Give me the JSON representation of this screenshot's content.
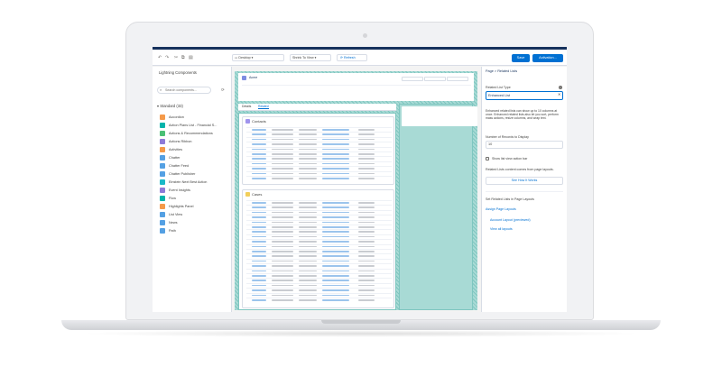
{
  "toolbar": {
    "device_label": "Desktop",
    "shrink_label": "Shrink To View",
    "refresh_label": "Refresh",
    "save_label": "Save",
    "activation_label": "Activation..."
  },
  "left_panel": {
    "title": "Lightning Components",
    "search_placeholder": "Search components...",
    "section_label": "Standard (33)",
    "components": [
      {
        "label": "Accordion",
        "color": "#f59a4a"
      },
      {
        "label": "Action Plans List - Financial S...",
        "color": "#04b4ab"
      },
      {
        "label": "Actions & Recommendations",
        "color": "#4bc076"
      },
      {
        "label": "Actions Ribbon",
        "color": "#8e7bd8"
      },
      {
        "label": "Activities",
        "color": "#f59a4a"
      },
      {
        "label": "Chatter",
        "color": "#54a0e3"
      },
      {
        "label": "Chatter Feed",
        "color": "#54a0e3"
      },
      {
        "label": "Chatter Publisher",
        "color": "#54a0e3"
      },
      {
        "label": "Einstein Next Best Action",
        "color": "#1ab9c8"
      },
      {
        "label": "Event Insights",
        "color": "#8e7bd8"
      },
      {
        "label": "Flow",
        "color": "#04b4ab"
      },
      {
        "label": "Highlights Panel",
        "color": "#f59a4a"
      },
      {
        "label": "List View",
        "color": "#54a0e3"
      },
      {
        "label": "News",
        "color": "#54a0e3"
      },
      {
        "label": "Path",
        "color": "#54a0e3"
      }
    ]
  },
  "canvas": {
    "account_name": "Acme",
    "tab_details": "Details",
    "tab_related": "Related",
    "contacts_title": "Contacts",
    "cases_title": "Cases"
  },
  "right_panel": {
    "breadcrumb": "Page  >  Related Lists",
    "list_type_label": "Related List Type",
    "list_type_value": "Enhanced List",
    "description": "Enhanced related lists can show up to 10 columns at once. Enhanced related lists also let you sort, perform mass actions, resize columns, and wrap text.",
    "records_label": "Number of Records to Display",
    "records_value": "10",
    "show_action_bar_label": "Show list view action bar",
    "content_note": "Related Lists content comes from page layouts.",
    "how_it_works_label": "See How It Works",
    "set_layouts_label": "Set Related Lists in Page Layouts",
    "assign_layouts_label": "Assign Page Layouts",
    "account_layout_label": "Account Layout (previewed)",
    "view_all_label": "View all layouts"
  }
}
